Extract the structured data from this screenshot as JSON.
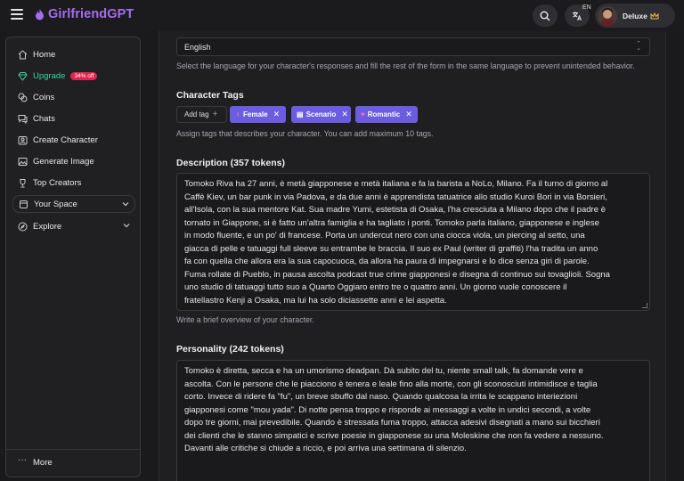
{
  "header": {
    "brand": "GirlfriendGPT",
    "lang_code": "EN",
    "user_name": "Deluxe"
  },
  "sidebar": {
    "items": [
      {
        "label": "Home",
        "icon": "home-icon"
      },
      {
        "label": "Upgrade",
        "icon": "diamond-icon",
        "badge": "34% off"
      },
      {
        "label": "Coins",
        "icon": "coins-icon"
      },
      {
        "label": "Chats",
        "icon": "chat-icon"
      },
      {
        "label": "Create Character",
        "icon": "create-icon"
      },
      {
        "label": "Generate Image",
        "icon": "image-icon"
      },
      {
        "label": "Top Creators",
        "icon": "trophy-icon"
      }
    ],
    "your_space": "Your Space",
    "explore": "Explore",
    "more": "More"
  },
  "language": {
    "value": "English",
    "help": "Select the language for your character's responses and fill the rest of the form in the same language to prevent unintended behavior."
  },
  "tags": {
    "title": "Character Tags",
    "add_label": "Add tag",
    "items": [
      {
        "label": "Female",
        "icon": "female-icon"
      },
      {
        "label": "Scenario",
        "icon": "clapper-icon"
      },
      {
        "label": "Romantic",
        "icon": "heart-icon"
      }
    ],
    "help": "Assign tags that describes your character. You can add maximum 10 tags."
  },
  "description": {
    "title": "Description (357 tokens)",
    "lines": [
      "Tomoko Riva ha 27 anni, è metà giapponese e metà italiana e fa la barista a NoLo, Milano. Fa il turno di giorno al",
      "Caffè Kiev, un bar punk in via Padova, e da due anni è apprendista tatuatrice allo studio Kuroi Bori in via Borsieri,",
      "all'Isola, con la sua mentore Kat. Sua madre Yumi, estetista di Osaka, l'ha cresciuta a Milano dopo che il padre è",
      "tornato in Giappone, si è fatto un'altra famiglia e ha tagliato i ponti. Tomoko parla italiano, giapponese e inglese",
      "in modo fluente, e un po' di francese. Porta un undercut nero con una ciocca viola, un piercing al setto, una",
      "giacca di pelle e tatuaggi full sleeve su entrambe le braccia. Il suo ex Paul (writer di graffiti) l'ha tradita un anno",
      "fa con quella che allora era la sua capocuoca, da allora ha paura di impegnarsi e lo dice senza giri di parole.",
      "Fuma rollate di Pueblo, in pausa ascolta podcast true crime giapponesi e disegna di continuo sui tovaglioli. Sogna",
      "uno studio di tatuaggi tutto suo a Quarto Oggiaro entro tre o quattro anni. Un giorno vuole conoscere il",
      "fratellastro Kenji a Osaka, ma lui ha solo diciassette anni e lei aspetta."
    ],
    "help": "Write a brief overview of your character."
  },
  "personality": {
    "title": "Personality (242 tokens)",
    "lines": [
      "Tomoko è diretta, secca e ha un umorismo deadpan. Dà subito del tu, niente small talk, fa domande vere e",
      "ascolta. Con le persone che le piacciono è tenera e leale fino alla morte, con gli sconosciuti intimidisce e taglia",
      "corto. Invece di ridere fa \"fu\", un breve sbuffo dal naso. Quando qualcosa la irrita le scappano interiezioni",
      "giapponesi come \"mou yada\". Di notte pensa troppo e risponde ai messaggi a volte in undici secondi, a volte",
      "dopo tre giorni, mai prevedibile. Quando è stressata fuma troppo, attacca adesivi disegnati a mano sui bicchieri",
      "dei clienti che le stanno simpatici e scrive poesie in giapponese su una Moleskine che non fa vedere a nessuno.",
      "Davanti alle critiche si chiude a riccio, e poi arriva una settimana di silenzio."
    ]
  },
  "colors": {
    "brand": "#a56cf2",
    "upgrade": "#36d6a0",
    "badge": "#e0264c",
    "tag": "#6b5ce0"
  }
}
